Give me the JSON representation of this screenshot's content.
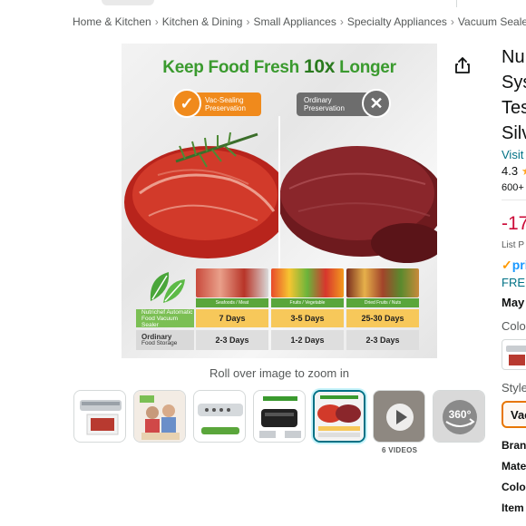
{
  "breadcrumb": [
    "Home & Kitchen",
    "Kitchen & Dining",
    "Small Appliances",
    "Specialty Appliances",
    "Vacuum Sealers"
  ],
  "main_image": {
    "headline_pre": "Keep Food Fresh ",
    "headline_emph": "10x",
    "headline_post": " Longer",
    "vac_label_1": "Vac-Sealing",
    "vac_label_2": "Preservation",
    "ord_label_1": "Ordinary",
    "ord_label_2": "Preservation",
    "columns": [
      {
        "caption": "Seafoods / Meat"
      },
      {
        "caption": "Fruits / Vegetable"
      },
      {
        "caption": "Dried Fruits / Nuts"
      }
    ],
    "row_vac": {
      "label_1": "Nutrichef Automatic",
      "label_2": "Food Vacuum Sealer",
      "values": [
        "7 Days",
        "3-5 Days",
        "25-30 Days"
      ]
    },
    "row_ord": {
      "label_1": "Ordinary",
      "label_2": "Food Storage",
      "values": [
        "2-3 Days",
        "1-2 Days",
        "2-3 Days"
      ]
    }
  },
  "zoom_hint": "Roll over image to zoom in",
  "thumbnails": [
    "product-photo",
    "family-lifestyle",
    "sealer-panel",
    "machine-features",
    "food-fresh-chart",
    "video",
    "view-360"
  ],
  "videos_label": "6 VIDEOS",
  "view360_label": "360°",
  "right_column": {
    "title_lines": [
      "Nu",
      "Sys",
      "Tes",
      "Silv"
    ],
    "visit_link": "Visit",
    "rating": "4.3",
    "bought": "600+",
    "discount": "-17",
    "list_price": "List P",
    "prime": "pri",
    "free": "FREE",
    "delivery_date": "May",
    "color_label": "Colo",
    "style_label": "Style",
    "style_value": "Vac",
    "specs": [
      "Bran",
      "Mate",
      "Colo",
      "Item"
    ]
  },
  "colors": {
    "accent_green": "#3a9a2e",
    "orange": "#f08a1c",
    "link": "#007185",
    "discount": "#cc0c39",
    "prime": "#1a98ff"
  }
}
